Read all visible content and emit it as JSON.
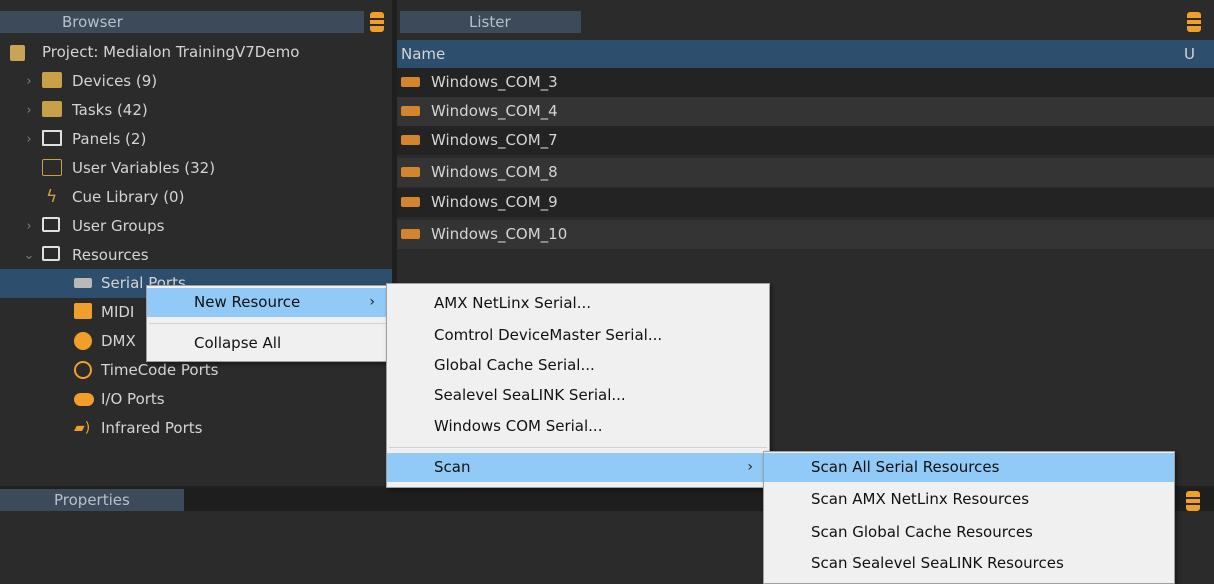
{
  "browser": {
    "title": "Browser",
    "project": "Project: Medialon TrainingV7Demo",
    "items": [
      {
        "label": "Devices (9)"
      },
      {
        "label": "Tasks (42)"
      },
      {
        "label": "Panels (2)"
      },
      {
        "label": "User Variables (32)"
      },
      {
        "label": "Cue Library (0)"
      },
      {
        "label": "User Groups"
      },
      {
        "label": "Resources"
      }
    ],
    "resources": [
      {
        "label": "Serial Ports"
      },
      {
        "label": "MIDI"
      },
      {
        "label": "DMX"
      },
      {
        "label": "TimeCode Ports"
      },
      {
        "label": "I/O Ports"
      },
      {
        "label": "Infrared Ports"
      }
    ]
  },
  "lister": {
    "title": "Lister",
    "col_name": "Name",
    "col_u": "U",
    "rows": [
      "Windows_COM_3",
      "Windows_COM_4",
      "Windows_COM_7",
      "Windows_COM_8",
      "Windows_COM_9",
      "Windows_COM_10"
    ]
  },
  "properties": {
    "title": "Properties"
  },
  "context_menu": {
    "new_resource": "New Resource",
    "collapse_all": "Collapse All"
  },
  "new_resource_menu": {
    "items": [
      "AMX NetLinx Serial...",
      "Comtrol DeviceMaster Serial...",
      "Global Cache Serial...",
      "Sealevel SeaLINK Serial...",
      "Windows COM Serial..."
    ],
    "scan": "Scan"
  },
  "scan_menu": {
    "items": [
      "Scan All Serial Resources",
      "Scan AMX NetLinx Resources",
      "Scan Global Cache Resources",
      "Scan Sealevel SeaLINK Resources"
    ]
  },
  "colors": {
    "background": "#2b2b2b",
    "header": "#3c4a5a",
    "selection": "#2e4e6e",
    "accent": "#f0a02a",
    "menu_highlight": "#91c9f7"
  }
}
